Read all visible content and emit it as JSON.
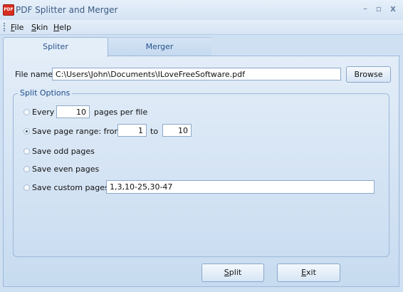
{
  "window": {
    "title": "PDF Splitter and Merger",
    "icon_text": "PDF"
  },
  "menu": {
    "items": [
      {
        "first": "F",
        "rest": "ile"
      },
      {
        "first": "S",
        "rest": "kin"
      },
      {
        "first": "H",
        "rest": "elp"
      }
    ]
  },
  "tabs": {
    "splitter": "Spliter",
    "merger": "Merger"
  },
  "file": {
    "label": "File name:",
    "value": "C:\\Users\\John\\Documents\\ILoveFreeSoftware.pdf",
    "browse_label": "Browse"
  },
  "split_options": {
    "title": "Split Options",
    "every_label": "Every",
    "every_value": "10",
    "every_suffix": "pages per file",
    "range_label": "Save page range: from",
    "range_from": "1",
    "range_to_label": "to",
    "range_to": "10",
    "odd_label": "Save odd pages",
    "even_label": "Save even pages",
    "custom_label": "Save custom pages:",
    "custom_value": "1,3,10-25,30-47",
    "selected": "range"
  },
  "actions": {
    "split_first": "S",
    "split_rest": "plit",
    "exit_first": "E",
    "exit_rest": "xit"
  }
}
